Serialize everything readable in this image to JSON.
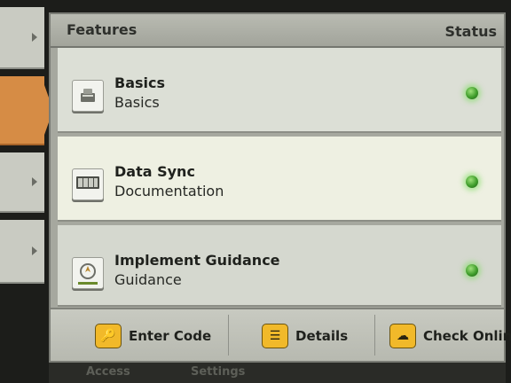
{
  "header": {
    "features_label": "Features",
    "status_label": "Status"
  },
  "features": [
    {
      "title": "Basics",
      "subtitle": "Basics",
      "icon": "basics-icon",
      "status_color": "#3f9d2b"
    },
    {
      "title": "Data Sync",
      "subtitle": "Documentation",
      "icon": "data-sync-icon",
      "status_color": "#3f9d2b"
    },
    {
      "title": "Implement Guidance",
      "subtitle": "Guidance",
      "icon": "guidance-icon",
      "status_color": "#3f9d2b"
    }
  ],
  "actions": {
    "enter_code": {
      "label": "Enter Code",
      "icon": "key-icon",
      "glyph": "🔑"
    },
    "details": {
      "label": "Details",
      "icon": "document-icon",
      "glyph": "☰"
    },
    "check_online": {
      "label": "Check Online",
      "icon": "cloud-download-icon",
      "glyph": "☁"
    }
  },
  "bottom_tabs": {
    "left": "Access",
    "right": "Settings"
  },
  "colors": {
    "accent": "#d68c45",
    "button_yellow": "#f1b92a"
  }
}
